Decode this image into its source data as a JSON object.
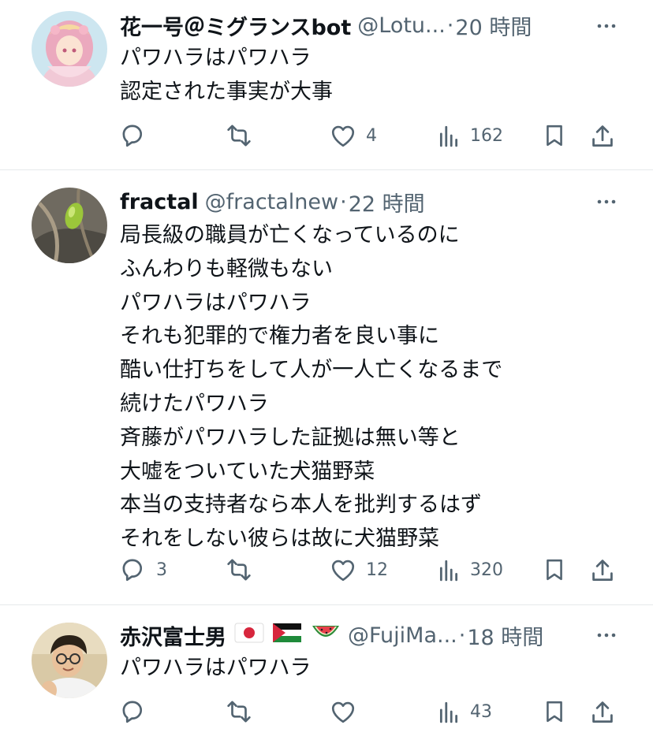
{
  "tweets": [
    {
      "name": "花一号＠ミグランスbot",
      "handle": "@Lotu...",
      "separator": "·",
      "time": "20 時間",
      "lines": [
        "パワハラはパワハラ",
        "認定された事実が大事"
      ],
      "stats": {
        "replies": "",
        "retweets": "",
        "likes": "4",
        "views": "162"
      }
    },
    {
      "name": "fractal",
      "handle": "@fractalnew",
      "separator": "·",
      "time": "22 時間",
      "lines": [
        "局長級の職員が亡くなっているのに",
        "ふんわりも軽微もない",
        "パワハラはパワハラ",
        "それも犯罪的で権力者を良い事に",
        "酷い仕打ちをして人が一人亡くなるまで",
        "続けたパワハラ",
        "斉藤がパワハラした証拠は無い等と",
        "大嘘をついていた犬猫野菜",
        "本当の支持者なら本人を批判するはず",
        "それをしない彼らは故に犬猫野菜"
      ],
      "stats": {
        "replies": "3",
        "retweets": "",
        "likes": "12",
        "views": "320"
      }
    },
    {
      "name": "赤沢富士男",
      "name_emojis": [
        "japan-flag",
        "palestine-flag",
        "watermelon"
      ],
      "handle": "@FujiMa...",
      "separator": "·",
      "time": "18 時間",
      "lines": [
        "パワハラはパワハラ"
      ],
      "stats": {
        "replies": "",
        "retweets": "",
        "likes": "",
        "views": "43"
      }
    }
  ],
  "colors": {
    "text": "#0f1419",
    "secondary": "#536471",
    "divider": "#e6e9eb"
  }
}
